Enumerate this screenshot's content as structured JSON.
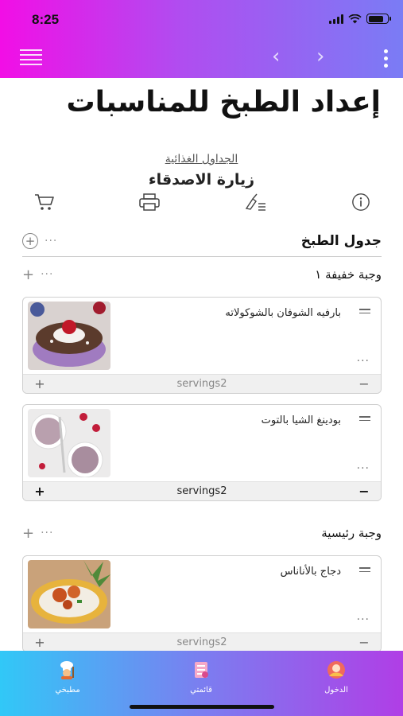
{
  "status_bar": {
    "time": "8:25"
  },
  "page": {
    "title": "إعداد الطبخ للمناسبات"
  },
  "plan": {
    "link": "الجداول الغذائية",
    "name": "زيارة الاصدقاء"
  },
  "section": {
    "title": "جدول الطبخ",
    "dots": "···"
  },
  "meals": [
    {
      "title": "وجبة خفيفة ١",
      "recipes": [
        {
          "name": "بارفيه الشوفان بالشوكولاته",
          "servings": "servings2",
          "dots": "···"
        },
        {
          "name": "بودينغ الشيا بالتوت",
          "servings": "servings2",
          "dots": "···"
        }
      ]
    },
    {
      "title": "وجبة رئيسية",
      "recipes": [
        {
          "name": "دجاج بالأناناس",
          "servings": "servings2",
          "dots": "···"
        }
      ]
    }
  ],
  "controls": {
    "plus": "+",
    "minus": "−",
    "circle_plus": "+",
    "dots": "···"
  },
  "tabs": [
    {
      "label": "مطبخي",
      "icon": "chef-icon"
    },
    {
      "label": "قائمتي",
      "icon": "list-icon"
    },
    {
      "label": "الدخول",
      "icon": "profile-icon"
    }
  ],
  "colors": {
    "header_gradient": [
      "#f20ee6",
      "#b04df0",
      "#7a7cf5"
    ],
    "tabbar_gradient": [
      "#31c8f7",
      "#7b7ef0",
      "#b03ee6"
    ]
  }
}
